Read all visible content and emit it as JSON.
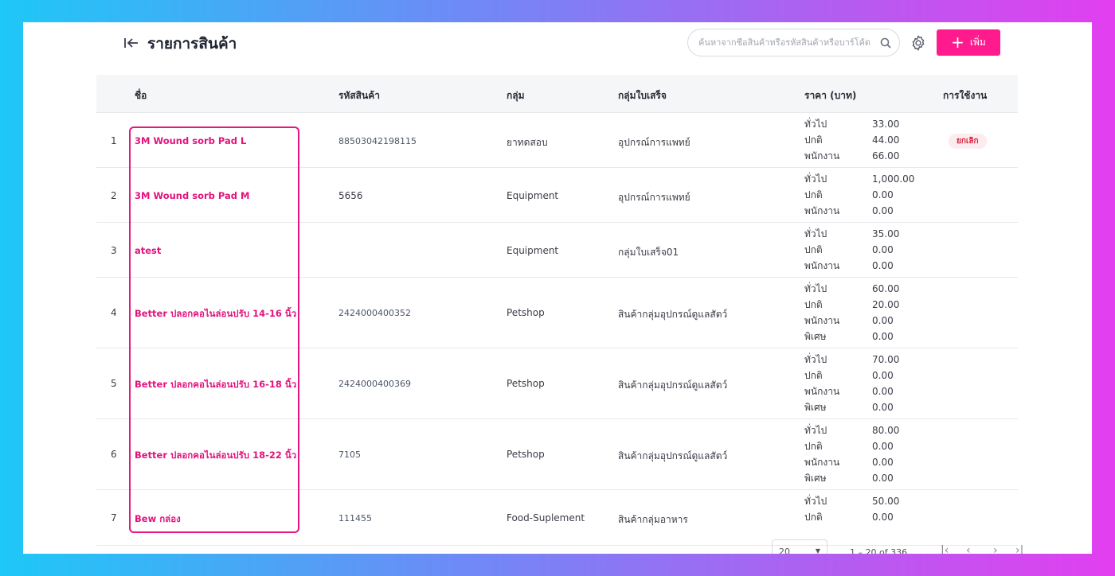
{
  "header": {
    "title": "รายการสินค้า",
    "search_placeholder": "ค้นหาจากชื่อสินค้าหรือรหัสสินค้าหรือบาร์โค้ด",
    "add_label": "เพิ่ม"
  },
  "colors": {
    "accent": "#ff1b8d",
    "name_link": "#e3127d",
    "badge_bg": "#fdecef",
    "badge_text": "#d8243f"
  },
  "table": {
    "columns": {
      "name": "ชื่อ",
      "code": "รหัสสินค้า",
      "group": "กลุ่ม",
      "license": "กลุ่มใบเสร็จ",
      "price": "ราคา (บาท)",
      "status": "การใช้งาน"
    },
    "rows": [
      {
        "no": "1",
        "name": "3M Wound sorb Pad L",
        "code": "88503042198115",
        "group": "ยาทดสอบ",
        "license": "อุปกรณ์การแพทย์",
        "prices": [
          {
            "label": "ทั่วไป",
            "value": "33.00"
          },
          {
            "label": "ปกติ",
            "value": "44.00"
          },
          {
            "label": "พนักงาน",
            "value": "66.00"
          }
        ],
        "status": "ยกเลิก"
      },
      {
        "no": "2",
        "name": "3M Wound sorb Pad M",
        "code": "5656",
        "group": "Equipment",
        "license": "อุปกรณ์การแพทย์",
        "prices": [
          {
            "label": "ทั่วไป",
            "value": "1,000.00"
          },
          {
            "label": "ปกติ",
            "value": "0.00"
          },
          {
            "label": "พนักงาน",
            "value": "0.00"
          }
        ],
        "status": ""
      },
      {
        "no": "3",
        "name": "atest",
        "code": "",
        "group": "Equipment",
        "license": "กลุ่มใบเสร็จ01",
        "prices": [
          {
            "label": "ทั่วไป",
            "value": "35.00"
          },
          {
            "label": "ปกติ",
            "value": "0.00"
          },
          {
            "label": "พนักงาน",
            "value": "0.00"
          }
        ],
        "status": ""
      },
      {
        "no": "4",
        "name": "Better ปลอกคอไนล่อนปรับ 14-16 นิ้ว",
        "code": "2424000400352",
        "group": "Petshop",
        "license": "สินค้ากลุ่มอุปกรณ์ดูแลสัตว์",
        "prices": [
          {
            "label": "ทั่วไป",
            "value": "60.00"
          },
          {
            "label": "ปกติ",
            "value": "20.00"
          },
          {
            "label": "พนักงาน",
            "value": "0.00"
          },
          {
            "label": "พิเศษ",
            "value": "0.00"
          }
        ],
        "status": ""
      },
      {
        "no": "5",
        "name": "Better ปลอกคอไนล่อนปรับ 16-18 นิ้ว",
        "code": "2424000400369",
        "group": "Petshop",
        "license": "สินค้ากลุ่มอุปกรณ์ดูแลสัตว์",
        "prices": [
          {
            "label": "ทั่วไป",
            "value": "70.00"
          },
          {
            "label": "ปกติ",
            "value": "0.00"
          },
          {
            "label": "พนักงาน",
            "value": "0.00"
          },
          {
            "label": "พิเศษ",
            "value": "0.00"
          }
        ],
        "status": ""
      },
      {
        "no": "6",
        "name": "Better ปลอกคอไนล่อนปรับ 18-22 นิ้ว",
        "code": "7105",
        "group": "Petshop",
        "license": "สินค้ากลุ่มอุปกรณ์ดูแลสัตว์",
        "prices": [
          {
            "label": "ทั่วไป",
            "value": "80.00"
          },
          {
            "label": "ปกติ",
            "value": "0.00"
          },
          {
            "label": "พนักงาน",
            "value": "0.00"
          },
          {
            "label": "พิเศษ",
            "value": "0.00"
          }
        ],
        "status": ""
      },
      {
        "no": "7",
        "name": "Bew กล่อง",
        "code": "111455",
        "group": "Food-Suplement",
        "license": "สินค้ากลุ่มอาหาร",
        "prices": [
          {
            "label": "ทั่วไป",
            "value": "50.00"
          },
          {
            "label": "ปกติ",
            "value": "0.00"
          }
        ],
        "status": ""
      }
    ]
  },
  "pagination": {
    "page_size": "20",
    "range": "1 – 20 of 336"
  }
}
